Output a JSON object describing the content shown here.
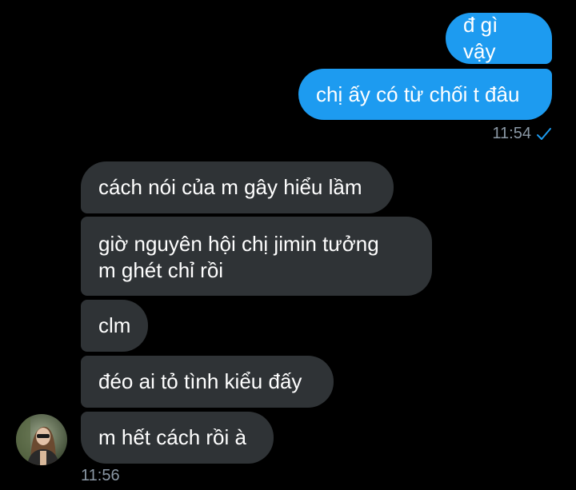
{
  "sent_messages": [
    {
      "text": "đ gì vậy"
    },
    {
      "text": "chị ấy có từ chối t đâu"
    }
  ],
  "sent_meta": {
    "time": "11:54",
    "status_icon": "check-icon"
  },
  "received_messages": [
    {
      "text": "cách nói của m gây hiểu lầm"
    },
    {
      "text": "giờ nguyên hội chị jimin tưởng m ghét chỉ rồi"
    },
    {
      "text": "clm"
    },
    {
      "text": "đéo ai tỏ tình kiểu đấy"
    },
    {
      "text": "m hết cách rồi à"
    }
  ],
  "received_meta": {
    "time": "11:56"
  },
  "colors": {
    "sent": "#1d9bf0",
    "received": "#2f3336",
    "timestamp": "#8b98a5",
    "background": "#000000"
  }
}
